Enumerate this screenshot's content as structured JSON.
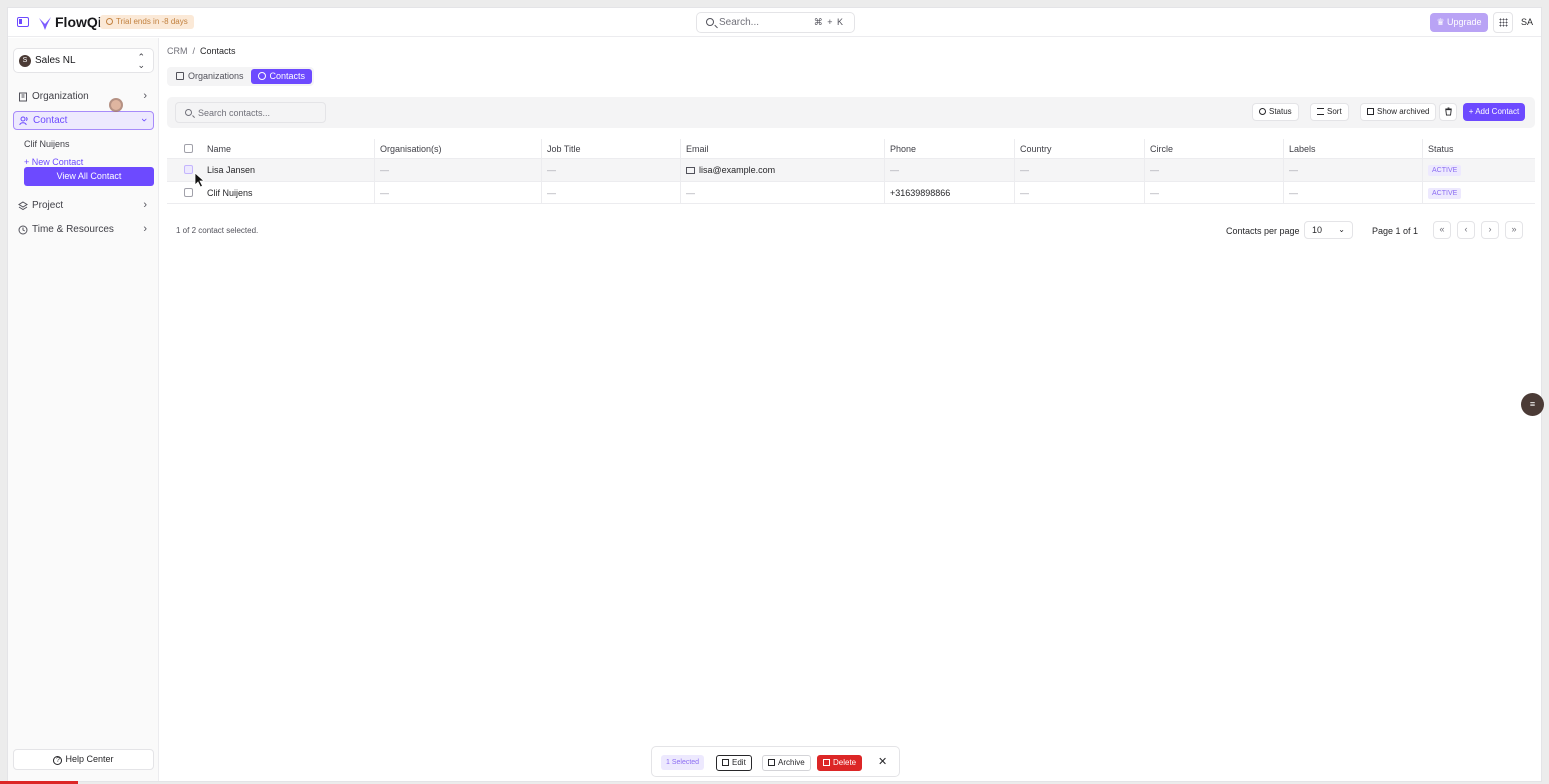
{
  "topbar": {
    "brand": "FlowQi",
    "trial_badge": "Trial ends in -8 days",
    "search_placeholder": "Search...",
    "search_shortcut": "⌘ + K",
    "upgrade_label": "Upgrade",
    "avatar_initials": "SA"
  },
  "sidebar": {
    "workspace": {
      "initial": "S",
      "name": "Sales NL"
    },
    "items": [
      {
        "label": "Organization"
      },
      {
        "label": "Contact"
      },
      {
        "label": "Project"
      },
      {
        "label": "Time & Resources"
      }
    ],
    "contact_sub": {
      "recent": "Clif Nuijens",
      "new_label": "New Contact",
      "view_all_label": "View All Contact"
    },
    "help_label": "Help Center"
  },
  "main": {
    "breadcrumb": {
      "root": "CRM",
      "current": "Contacts"
    },
    "tabs": [
      {
        "label": "Organizations"
      },
      {
        "label": "Contacts"
      }
    ],
    "toolbar": {
      "search_placeholder": "Search contacts...",
      "status_label": "Status",
      "sort_label": "Sort",
      "show_archived_label": "Show archived",
      "add_contact_label": "+ Add Contact"
    },
    "table": {
      "columns": [
        "Name",
        "Organisation(s)",
        "Job Title",
        "Email",
        "Phone",
        "Country",
        "Circle",
        "Labels",
        "Status"
      ],
      "rows": [
        {
          "name": "Lisa Jansen",
          "organisations": "—",
          "job_title": "—",
          "email": "lisa@example.com",
          "phone": "—",
          "country": "—",
          "circle": "—",
          "labels": "—",
          "status": "ACTIVE"
        },
        {
          "name": "Clif Nuijens",
          "organisations": "—",
          "job_title": "—",
          "email": "—",
          "phone": "+31639898866",
          "country": "—",
          "circle": "—",
          "labels": "—",
          "status": "ACTIVE"
        }
      ]
    },
    "footer": {
      "selection_info": "1 of 2 contact selected.",
      "per_page_label": "Contacts per page",
      "per_page_value": "10",
      "page_info": "Page 1 of 1"
    }
  },
  "bulk_bar": {
    "selected_label": "1 Selected",
    "edit_label": "Edit",
    "archive_label": "Archive",
    "delete_label": "Delete"
  },
  "colors": {
    "accent": "#6d4aff",
    "danger": "#dc2626",
    "trial": "#fbe9d7"
  }
}
